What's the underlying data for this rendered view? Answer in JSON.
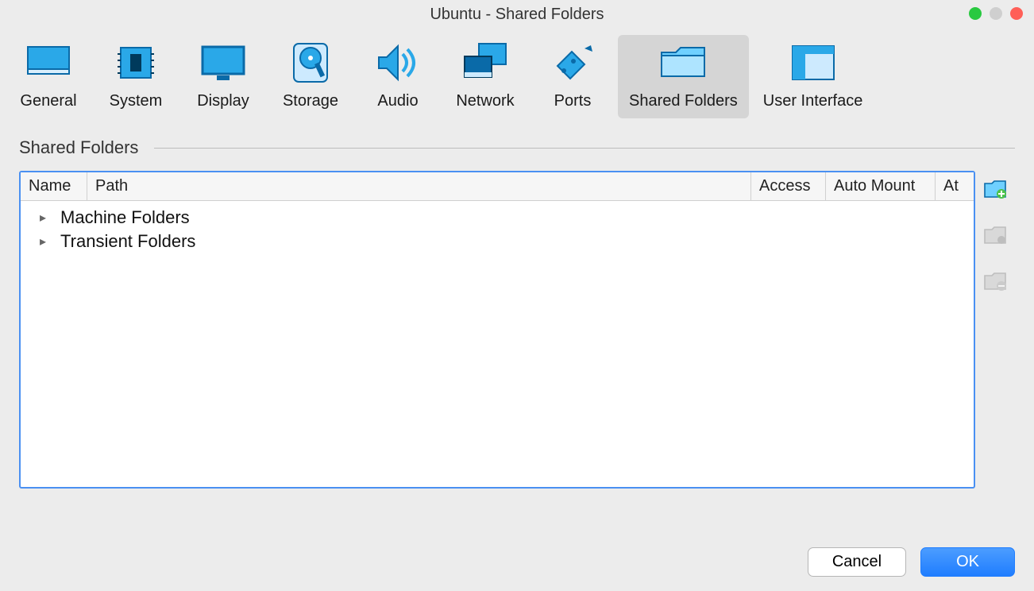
{
  "window": {
    "title": "Ubuntu - Shared Folders"
  },
  "toolbar": {
    "items": [
      {
        "label": "General"
      },
      {
        "label": "System"
      },
      {
        "label": "Display"
      },
      {
        "label": "Storage"
      },
      {
        "label": "Audio"
      },
      {
        "label": "Network"
      },
      {
        "label": "Ports"
      },
      {
        "label": "Shared Folders"
      },
      {
        "label": "User Interface"
      }
    ],
    "selected_index": 7
  },
  "section": {
    "title": "Shared Folders"
  },
  "table": {
    "columns": {
      "name": "Name",
      "path": "Path",
      "access": "Access",
      "automount": "Auto Mount",
      "at": "At"
    },
    "groups": [
      {
        "label": "Machine Folders"
      },
      {
        "label": "Transient Folders"
      }
    ]
  },
  "side_actions": {
    "add": "Add shared folder",
    "edit": "Edit shared folder",
    "remove": "Remove shared folder"
  },
  "footer": {
    "cancel": "Cancel",
    "ok": "OK"
  }
}
